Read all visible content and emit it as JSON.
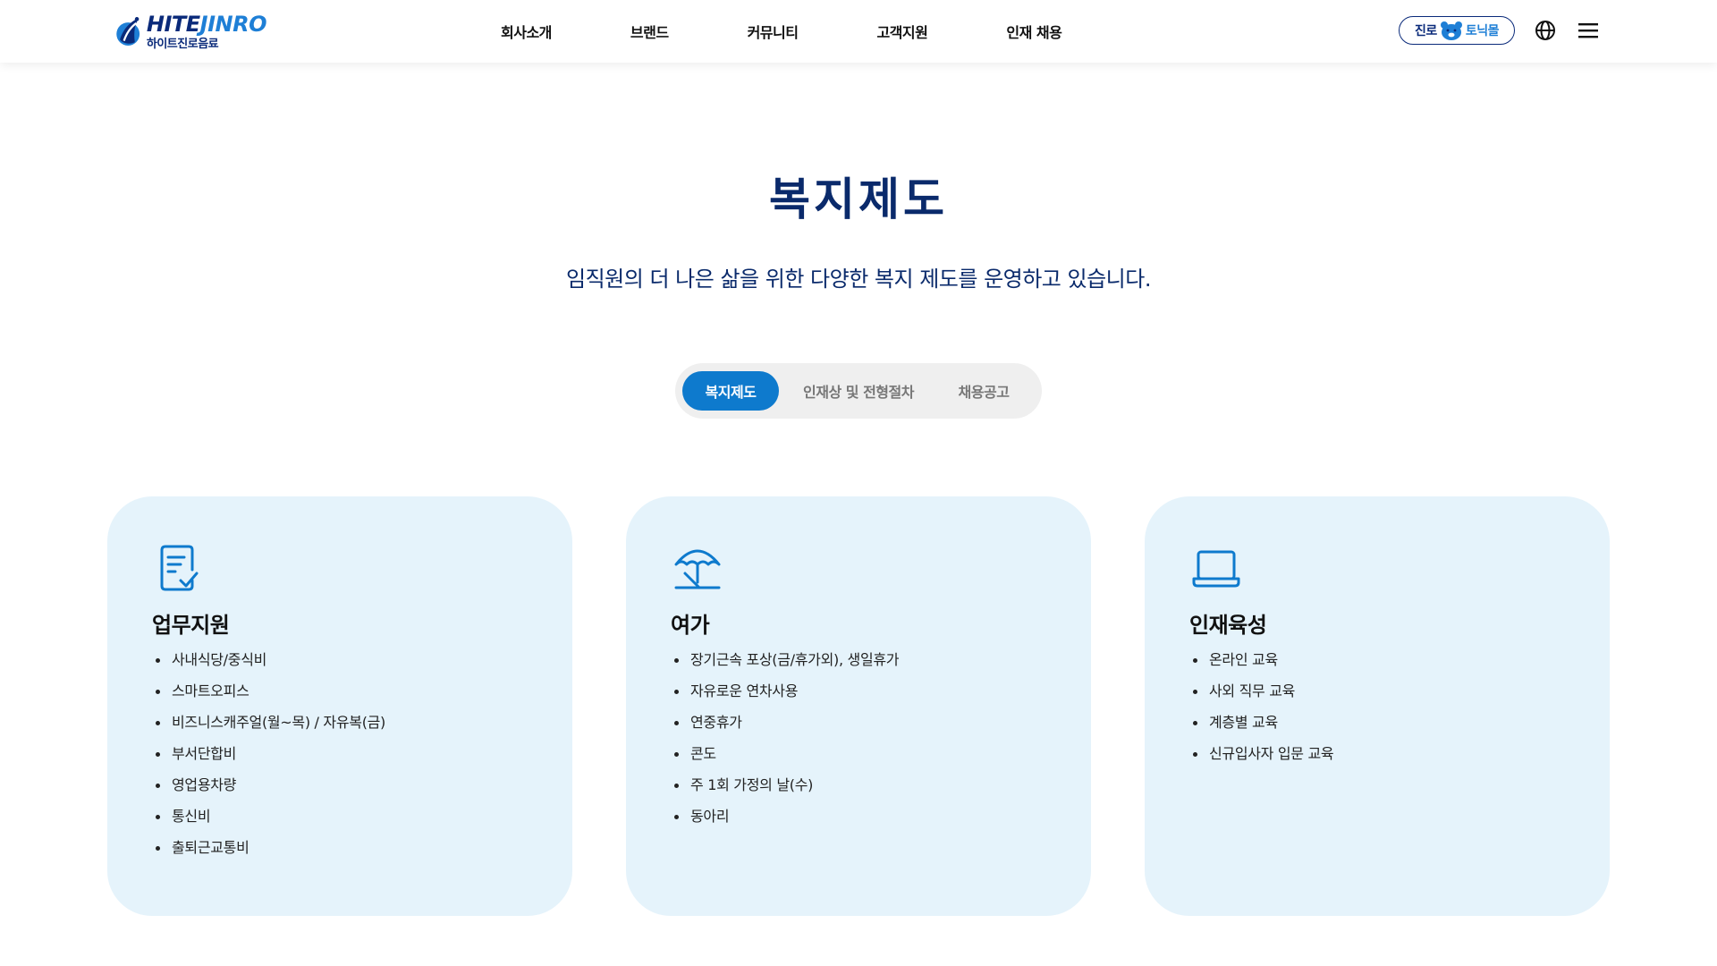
{
  "header": {
    "logo": {
      "en_part1": "HITE",
      "en_part2": "JINRO",
      "ko": "하이트진로음료"
    },
    "nav": [
      "회사소개",
      "브랜드",
      "커뮤니티",
      "고객지원",
      "인재 채용"
    ],
    "mall": {
      "left": "진로",
      "right": "토닉몰"
    },
    "icons": {
      "language": "globe-icon",
      "menu": "hamburger-menu-icon"
    }
  },
  "page": {
    "title": "복지제도",
    "subtitle": "임직원의 더 나은 삶을 위한 다양한 복지 제도를 운영하고 있습니다."
  },
  "tabs": [
    {
      "label": "복지제도",
      "active": true
    },
    {
      "label": "인재상 및 전형절차",
      "active": false
    },
    {
      "label": "채용공고",
      "active": false
    }
  ],
  "cards": [
    {
      "icon": "document-check-icon",
      "title": "업무지원",
      "items": [
        "사내식당/중식비",
        "스마트오피스",
        "비즈니스캐주얼(월~목) / 자유복(금)",
        "부서단합비",
        "영업용차량",
        "통신비",
        "출퇴근교통비"
      ]
    },
    {
      "icon": "beach-umbrella-icon",
      "title": "여가",
      "items": [
        "장기근속 포상(금/휴가외), 생일휴가",
        "자유로운 연차사용",
        "연중휴가",
        "콘도",
        "주 1회 가정의 날(수)",
        "동아리"
      ]
    },
    {
      "icon": "laptop-icon",
      "title": "인재육성",
      "items": [
        "온라인 교육",
        "사외 직무 교육",
        "계층별 교육",
        "신규입사자 입문 교육"
      ]
    }
  ],
  "colors": {
    "primary": "#0e7acd",
    "navy": "#0a2a6b",
    "card_bg": "#e5f3fb",
    "tab_bg": "#efefef"
  }
}
